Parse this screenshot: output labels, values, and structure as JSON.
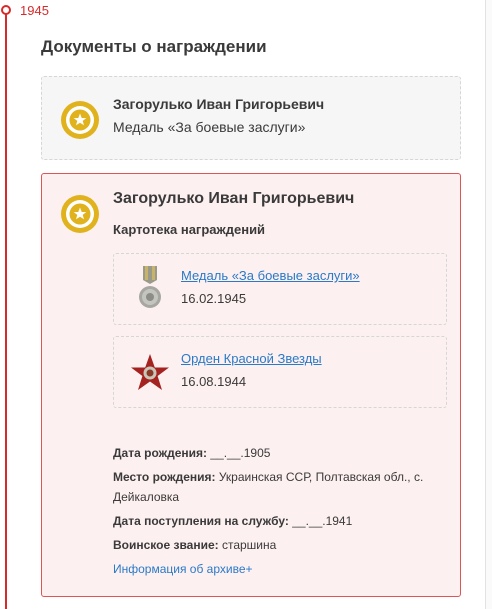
{
  "timeline": {
    "year": "1945",
    "accent_color": "#d62b2b"
  },
  "section": {
    "title": "Документы о награждении"
  },
  "document_card": {
    "name": "Загорулько Иван Григорьевич",
    "award": "Медаль «За боевые заслуги»",
    "icon": "medal-star-icon"
  },
  "file_card": {
    "name": "Загорулько Иван Григорьевич",
    "subtitle": "Картотека награждений",
    "icon": "medal-star-icon",
    "awards": [
      {
        "title": "Медаль «За боевые заслуги»",
        "date": "16.02.1945",
        "icon": "medal-image"
      },
      {
        "title": "Орден Красной Звезды",
        "date": "16.08.1944",
        "icon": "red-star-order-image"
      }
    ],
    "details": {
      "birth_date_label": "Дата рождения:",
      "birth_date_value": " __.__.1905",
      "birth_place_label": "Место рождения:",
      "birth_place_value": " Украинская ССР, Полтавская обл., с. Дейкаловка",
      "service_date_label": "Дата поступления на службу:",
      "service_date_value": " __.__.1941",
      "rank_label": "Воинское звание:",
      "rank_value": " старшина"
    },
    "archive_link": "Информация об архиве+"
  },
  "colors": {
    "link": "#2a7ac8",
    "badge": "#e0b31e",
    "card_border": "#df5454",
    "card_bg": "#fdf0f0"
  }
}
